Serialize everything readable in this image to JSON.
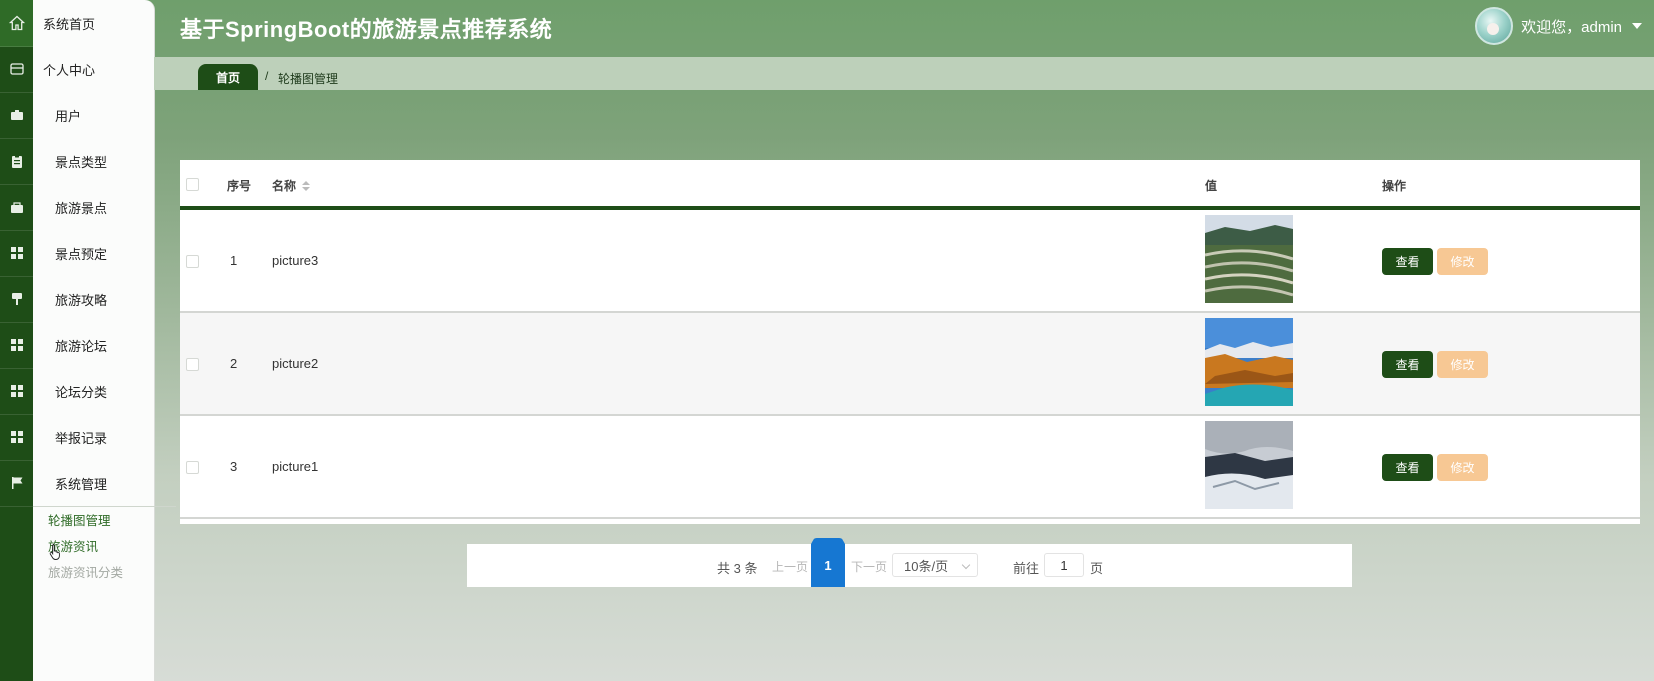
{
  "app": {
    "title": "基于SpringBoot的旅游景点推荐系统"
  },
  "user": {
    "greeting": "欢迎您，admin"
  },
  "sidebar": {
    "items": [
      {
        "label": "系统首页",
        "icon": "home-icon"
      },
      {
        "label": "个人中心",
        "icon": "wallet-icon"
      },
      {
        "label": "用户",
        "icon": "briefcase-icon"
      },
      {
        "label": "景点类型",
        "icon": "clipboard-icon"
      },
      {
        "label": "旅游景点",
        "icon": "bag-icon"
      },
      {
        "label": "景点预定",
        "icon": "grid-icon"
      },
      {
        "label": "旅游攻略",
        "icon": "brush-icon"
      },
      {
        "label": "旅游论坛",
        "icon": "grid-icon"
      },
      {
        "label": "论坛分类",
        "icon": "grid-icon"
      },
      {
        "label": "举报记录",
        "icon": "grid-icon"
      },
      {
        "label": "系统管理",
        "icon": "flag-icon"
      }
    ],
    "submenu": [
      {
        "label": "轮播图管理",
        "state": "active"
      },
      {
        "label": "旅游资讯",
        "state": "active"
      },
      {
        "label": "旅游资讯分类",
        "state": "disabled"
      }
    ]
  },
  "breadcrumb": {
    "home": "首页",
    "separator": "/",
    "current": "轮播图管理"
  },
  "table": {
    "columns": [
      "序号",
      "名称",
      "值",
      "操作"
    ],
    "rows": [
      {
        "index": "1",
        "name": "picture3",
        "image": "terraced-hills-photo"
      },
      {
        "index": "2",
        "name": "picture2",
        "image": "mountain-lake-photo"
      },
      {
        "index": "3",
        "name": "picture1",
        "image": "snowy-valley-photo"
      }
    ],
    "view_label": "查看",
    "edit_label": "修改"
  },
  "pagination": {
    "total": "共 3 条",
    "prev": "上一页",
    "current_page": "1",
    "next": "下一页",
    "page_size": "10条/页",
    "goto": "前往",
    "goto_value": "1",
    "unit": "页"
  },
  "colors": {
    "primary": "#1e4d17",
    "edit_button": "#f7c894",
    "page_active": "#1677d2"
  }
}
